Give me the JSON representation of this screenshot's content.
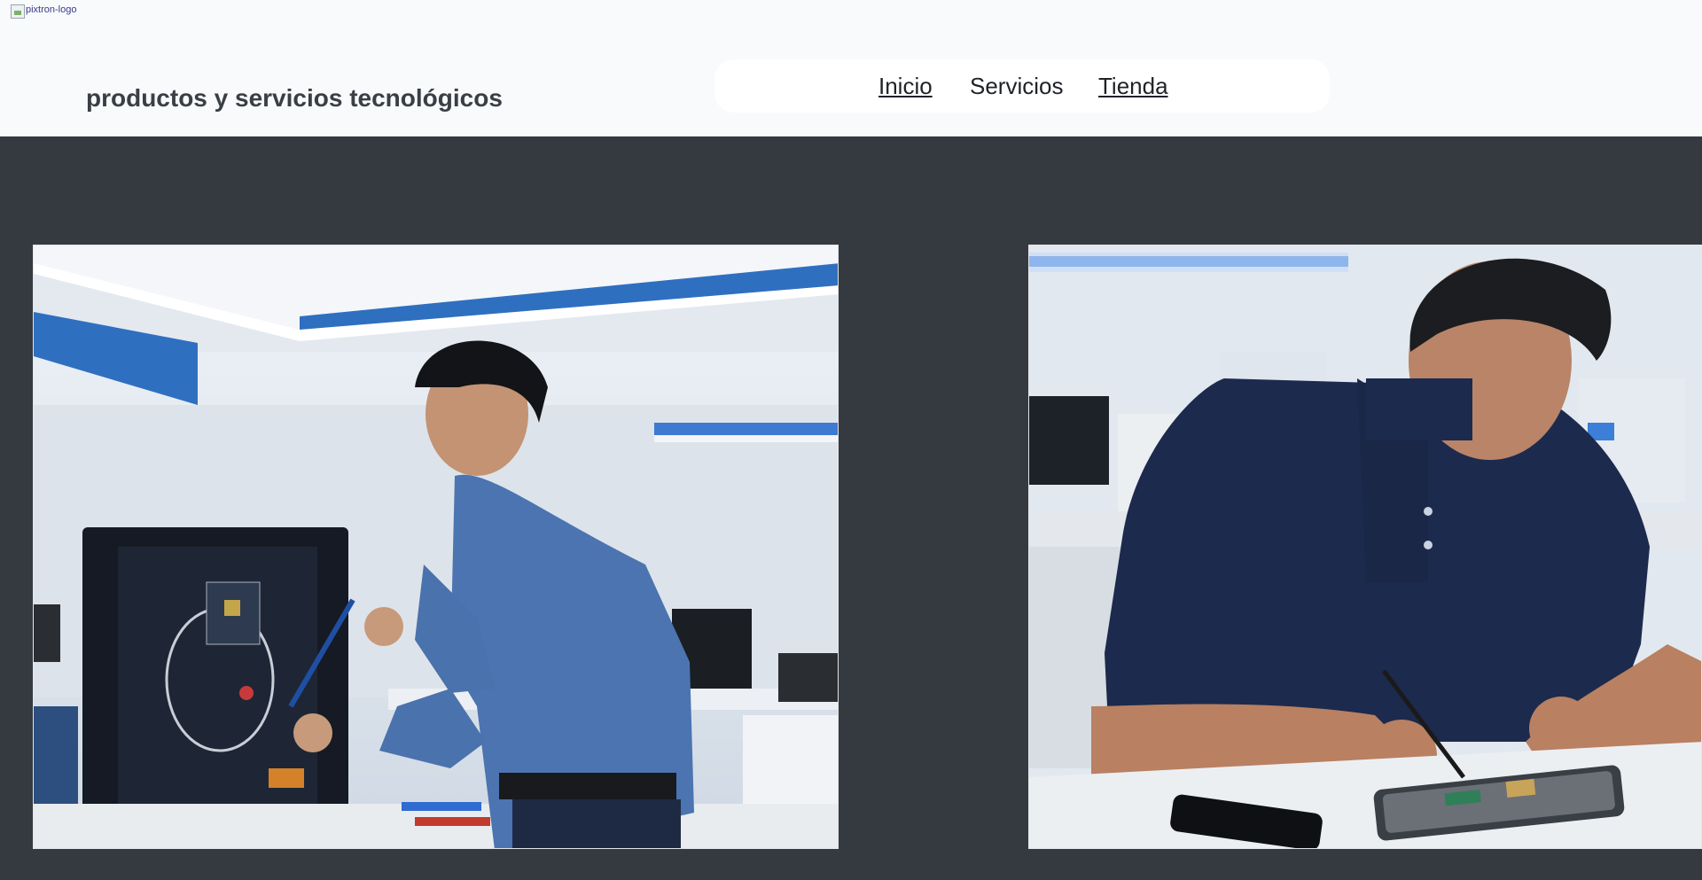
{
  "header": {
    "logo_alt": "pixtron-logo",
    "tagline": "productos y servicios tecnológicos",
    "background": "#f8fafc"
  },
  "nav": {
    "items": [
      {
        "label": "Inicio",
        "underlined": true
      },
      {
        "label": "Servicios",
        "underlined": false
      },
      {
        "label": "Tienda",
        "underlined": true
      }
    ]
  },
  "hero": {
    "background": "#343a40",
    "images": [
      {
        "description": "technician-repairing-monitor-icon"
      },
      {
        "description": "technician-repairing-smartphone-icon"
      }
    ]
  }
}
